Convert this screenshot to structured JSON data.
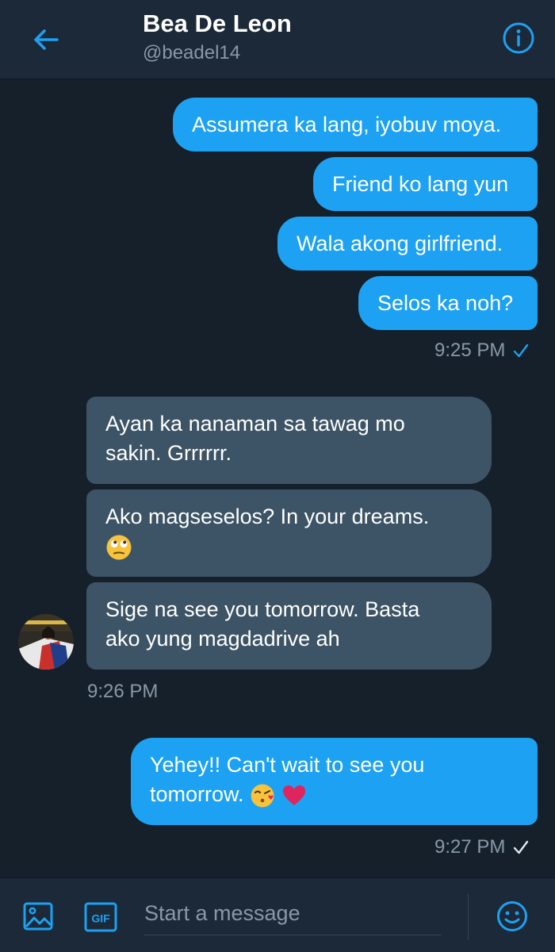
{
  "header": {
    "name": "Bea De Leon",
    "handle": "@beadel14",
    "back_icon": "arrow-left-icon",
    "info_icon": "info-icon"
  },
  "conversation": {
    "outgoing_group_1": [
      "Assumera ka lang, iyobuv moya.",
      "Friend ko lang yun",
      "Wala akong girlfriend.",
      "Selos ka noh?"
    ],
    "outgoing_group_1_time": "9:25 PM",
    "incoming_group": [
      {
        "text": "Ayan ka nanaman sa tawag mo",
        "text2": "sakin. Grrrrrr."
      },
      {
        "text": "Ako magseselos? In your dreams.",
        "emoji": "rolling-eyes-emoji"
      },
      {
        "text": "Sige na see you tomorrow. Basta",
        "text2": "ako yung magdadrive ah"
      }
    ],
    "incoming_group_time": "9:26 PM",
    "outgoing_group_2": {
      "line1": "Yehey!! Can't wait to see you",
      "line2": "tomorrow.",
      "emojis": [
        "kissing-face-emoji",
        "red-heart-emoji"
      ]
    },
    "outgoing_group_2_time": "9:27 PM"
  },
  "composer": {
    "placeholder": "Start a message",
    "image_icon": "image-icon",
    "gif_label": "GIF",
    "emoji_icon": "smiley-icon"
  },
  "colors": {
    "background": "#15202b",
    "bar": "#1c2938",
    "accent": "#1da1f2",
    "incoming_bubble": "#3d5466",
    "muted_text": "#8899a6"
  }
}
